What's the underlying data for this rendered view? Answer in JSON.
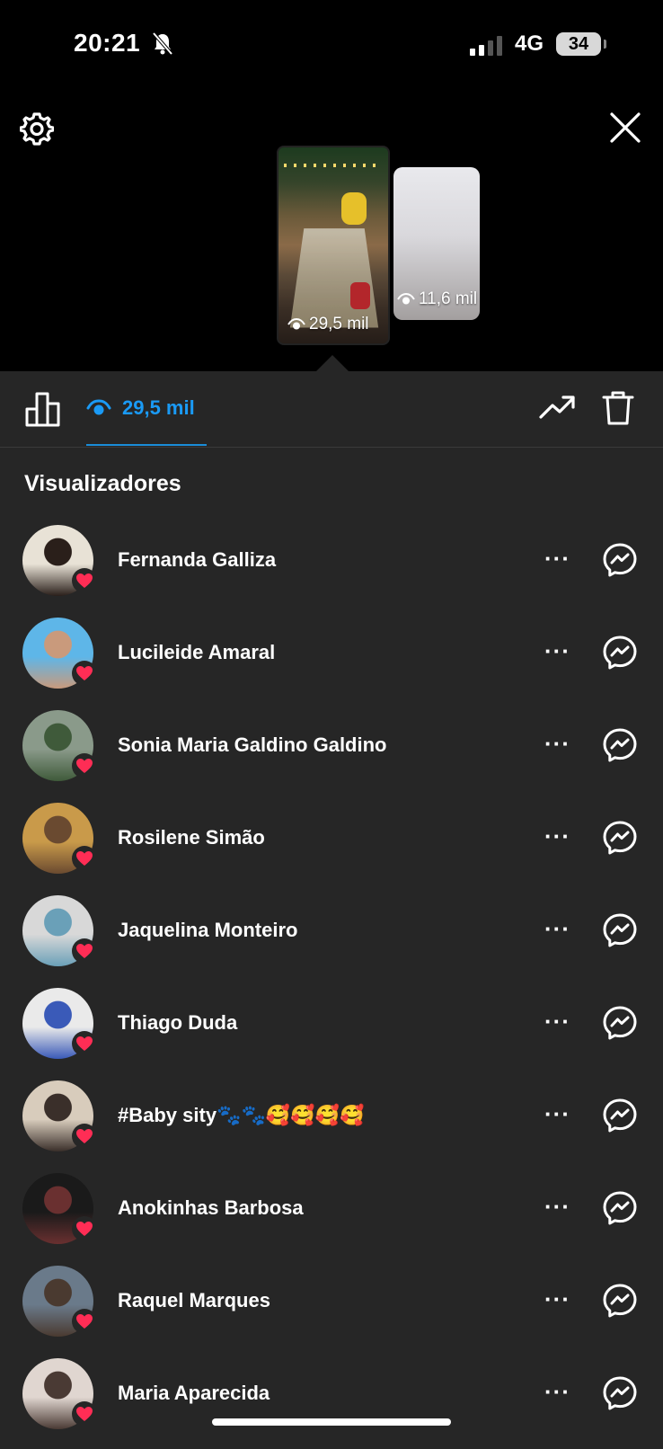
{
  "status_bar": {
    "time": "20:21",
    "network": "4G",
    "battery": "34"
  },
  "stories": [
    {
      "views": "29,5 mil",
      "selected": true
    },
    {
      "views": "11,6 mil",
      "selected": false
    }
  ],
  "tabs": {
    "viewers_count": "29,5 mil"
  },
  "section_title": "Visualizadores",
  "viewers": [
    {
      "name": "Fernanda Galliza",
      "avatar_colors": [
        "#e8e2d6",
        "#2a1f1a"
      ]
    },
    {
      "name": "Lucileide Amaral",
      "avatar_colors": [
        "#5eb6e8",
        "#c99a7c"
      ]
    },
    {
      "name": "Sonia Maria Galdino Galdino",
      "avatar_colors": [
        "#8a9a8a",
        "#3f5a3a"
      ]
    },
    {
      "name": "Rosilene Simão",
      "avatar_colors": [
        "#c99a4a",
        "#6a4a30"
      ]
    },
    {
      "name": "Jaquelina Monteiro",
      "avatar_colors": [
        "#d8d8d8",
        "#6aa0b8"
      ]
    },
    {
      "name": "Thiago Duda",
      "avatar_colors": [
        "#eaeaea",
        "#3a5ab8"
      ]
    },
    {
      "name": "#Baby sity🐾🐾🥰🥰🥰🥰",
      "avatar_colors": [
        "#d8ccbc",
        "#3a2f2a"
      ]
    },
    {
      "name": "Anokinhas Barbosa",
      "avatar_colors": [
        "#1a1a1a",
        "#6a3030"
      ]
    },
    {
      "name": "Raquel Marques",
      "avatar_colors": [
        "#6a7a8a",
        "#4a3a30"
      ]
    },
    {
      "name": "Maria Aparecida",
      "avatar_colors": [
        "#e0d6d0",
        "#4a3a34"
      ]
    }
  ],
  "colors": {
    "accent": "#1a9af5",
    "heart": "#ff2d55",
    "background": "#262626"
  }
}
